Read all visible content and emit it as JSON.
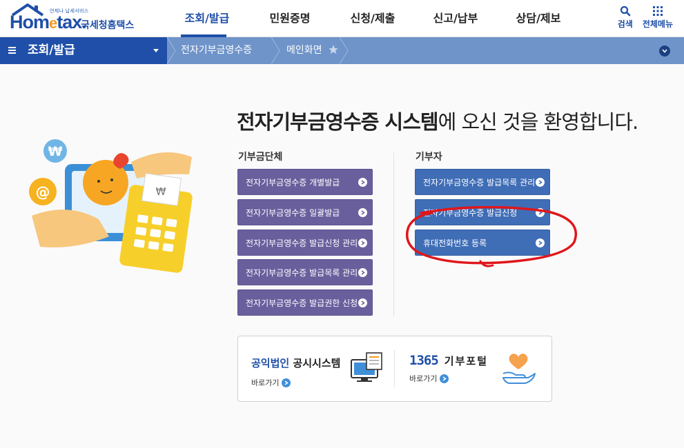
{
  "header": {
    "logo_slogan": "언제나 납세서비스",
    "logo_brand_a": "Hom",
    "logo_brand_e": "e",
    "logo_brand_b": "tax.",
    "logo_org": "국세청홈택스",
    "menus": [
      "조회/발급",
      "민원증명",
      "신청/제출",
      "신고/납부",
      "상담/제보"
    ],
    "search_label": "검색",
    "allmenu_label": "전체메뉴"
  },
  "navbar": {
    "lnb_label": "조회/발급",
    "crumb1": "전자기부금영수증",
    "crumb2": "메인화면"
  },
  "main": {
    "welcome_bold": "전자기부금영수증 시스템",
    "welcome_rest": "에 오신 것을 환영합니다.",
    "org_group_title": "기부금단체",
    "org_buttons": [
      "전자기부금영수증 개별발급",
      "전자기부금영수증 일괄발급",
      "전자기부금영수증 발급신청 관리",
      "전자기부금영수증 발급목록 관리",
      "전자기부금영수증 발급권한 신청"
    ],
    "donor_group_title": "기부자",
    "donor_buttons": [
      "전자기부금영수증 발급목록 관리",
      "전자기부금영수증 발급신청",
      "휴대전화번호 등록"
    ]
  },
  "links": {
    "disclosure_blue": "공익법인",
    "disclosure_rest": " 공시시스템",
    "disclosure_go": "바로가기",
    "portal_number": "1365",
    "portal_word": "기부포털",
    "portal_go": "바로가기"
  },
  "colors": {
    "brand_blue": "#1f4fa8",
    "nav_bar": "#6f94c9",
    "org_button": "#6a5f9d",
    "donor_button": "#3f6db6",
    "annotation": "#e0161b"
  }
}
